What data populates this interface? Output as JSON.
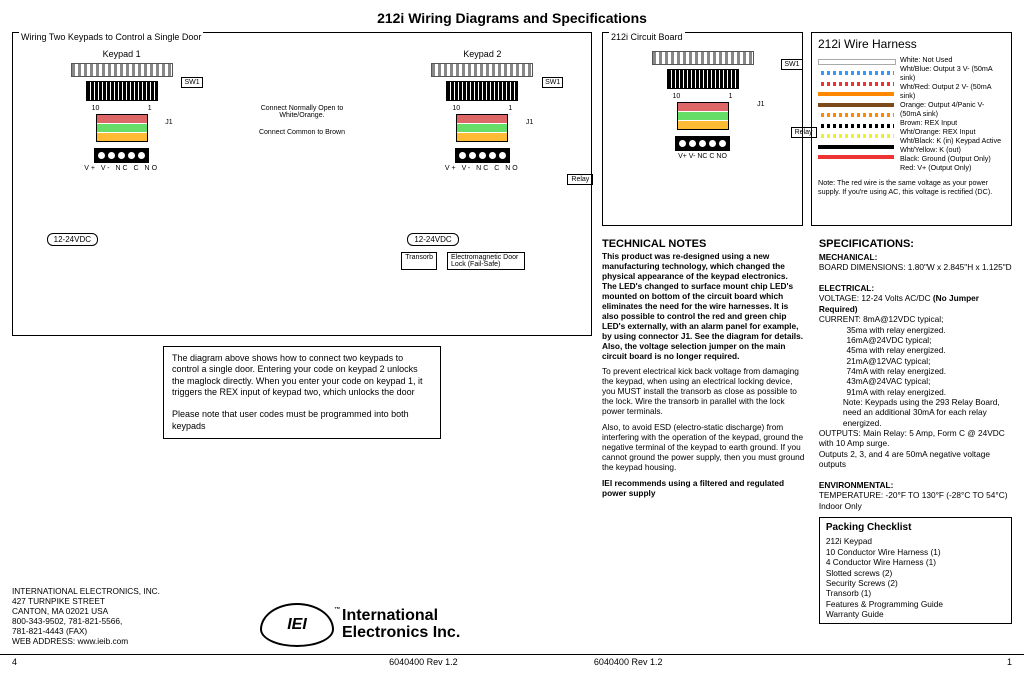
{
  "title": "212i Wiring Diagrams and Specifications",
  "wiring_box_title": "Wiring Two Keypads to Control a Single Door",
  "keypad1_label": "Keypad 1",
  "keypad2_label": "Keypad 2",
  "sw1": "SW1",
  "j1": "J1",
  "num10": "10",
  "num1": "1",
  "relay": "Relay",
  "term_labels": "V+ V- NC C NO",
  "vdc": "12-24VDC",
  "note_nopen": "Connect Normally Open to White/Orange.",
  "note_common": "Connect Common to Brown",
  "transorb": "Transorb",
  "emlock": "Electromagnetic Door Lock (Fail-Safe)",
  "explain_p1": "The diagram above shows how to connect two keypads to control a single door. Entering your code on keypad 2 unlocks the maglock directly. When you enter your code on keypad 1, it triggers the REX input of keypad two, which unlocks the door",
  "explain_p2": "Please note that user codes must be programmed into both keypads",
  "circuit_box_title": "212i Circuit Board",
  "cb_term_labels": "V+ V- NC C NO",
  "harness_title": "212i Wire Harness",
  "harness_lines": [
    {
      "c": "#fff",
      "t": "White: Not Used"
    },
    {
      "c": "repeating-linear-gradient(90deg,#fff 0 3px,#39f 3px 6px)",
      "t": "Wht/Blue: Output 3 V- (50mA sink)"
    },
    {
      "c": "repeating-linear-gradient(90deg,#fff 0 3px,#e33 3px 6px)",
      "t": "Wht/Red: Output 2 V- (50mA sink)"
    },
    {
      "c": "#f80",
      "t": "Orange: Output 4/Panic V- (50mA sink)"
    },
    {
      "c": "#7a4a1a",
      "t": "Brown: REX Input"
    },
    {
      "c": "repeating-linear-gradient(90deg,#fff 0 3px,#f80 3px 6px)",
      "t": "Wht/Orange: REX Input"
    },
    {
      "c": "repeating-linear-gradient(90deg,#fff 0 3px,#000 3px 6px)",
      "t": "Wht/Black: K (in) Keypad Active"
    },
    {
      "c": "repeating-linear-gradient(90deg,#fff 0 3px,#ee3 3px 6px)",
      "t": "Wht/Yellow: K (out)"
    },
    {
      "c": "#000",
      "t": "Black: Ground (Output Only)"
    },
    {
      "c": "#e33",
      "t": "Red: V+ (Output Only)"
    }
  ],
  "harness_note": "Note: The red wire is the same voltage as your power supply. If you're using AC, this voltage is rectified (DC).",
  "tech_heading": "TECHNICAL NOTES",
  "tech_p1": "This product was re-designed using a new manufacturing technology, which changed the physical appearance of the keypad electronics.  The LED's changed to surface mount chip LED's mounted on bottom of the circuit board which eliminates the need for the wire harnesses.  It is also possible to control the red and green chip LED's externally, with an alarm panel for example, by using connector J1.  See the diagram for details.  Also, the voltage selection jumper on the main circuit board is no longer required.",
  "tech_p2": "To prevent electrical kick back voltage from damaging the keypad, when using an electrical locking device, you MUST install the transorb as close as possible to the lock. Wire the transorb in parallel with the lock power terminals.",
  "tech_p3": "Also, to avoid ESD (electro-static discharge) from interfering with the operation of the keypad, ground the negative terminal of the keypad to earth ground.  If you cannot ground the power supply, then you must ground the keypad housing.",
  "tech_p4": "IEI recommends using a filtered and regulated power supply",
  "spec_heading": "SPECIFICATIONS:",
  "spec_mech_h": "MECHANICAL:",
  "spec_mech": "BOARD DIMENSIONS: 1.80\"W x 2.845\"H x 1.125\"D",
  "spec_elec_h": "ELECTRICAL:",
  "spec_volt": "VOLTAGE: 12-24 Volts AC/DC (No Jumper Required)",
  "spec_volt_b": "(No Jumper Required)",
  "spec_curr": "CURRENT: 8mA@12VDC typical;",
  "spec_curr_lines": "            35ma with relay energized.\n            16mA@24VDC typical;\n            45ma with relay energized.\n            21mA@12VAC typical;\n            74mA with relay energized.\n            43mA@24VAC typical;\n            91mA with relay energized.",
  "spec_note": "Note: Keypads using the 293 Relay Board, need an additional 30mA for each relay energized.",
  "spec_out": "OUTPUTS: Main Relay: 5 Amp, Form C @ 24VDC with 10 Amp surge.\nOutputs 2, 3, and 4 are 50mA negative voltage outputs",
  "spec_env_h": "ENVIRONMENTAL:",
  "spec_env": "TEMPERATURE:  -20°F TO 130°F (-28°C TO 54°C)\nIndoor Only",
  "packing_title": "Packing Checklist",
  "packing_items": "212i Keypad\n10 Conductor Wire Harness (1)\n4 Conductor Wire Harness (1)\nSlotted screws (2)\nSecurity Screws (2)\nTransorb (1)\nFeatures & Programming Guide\nWarranty Guide",
  "company": "INTERNATIONAL ELECTRONICS, INC.\n427 TURNPIKE STREET\nCANTON, MA  02021  USA\n800-343-9502, 781-821-5566,\n781-821-4443 (FAX)\nWEB ADDRESS:  www.ieib.com",
  "logo_text1": "International",
  "logo_text2": "Electronics Inc.",
  "logo_abbrev": "IEI",
  "tm": "™",
  "footer_left": "4",
  "footer_mid": "6040400 Rev 1.2",
  "footer_right": "1"
}
